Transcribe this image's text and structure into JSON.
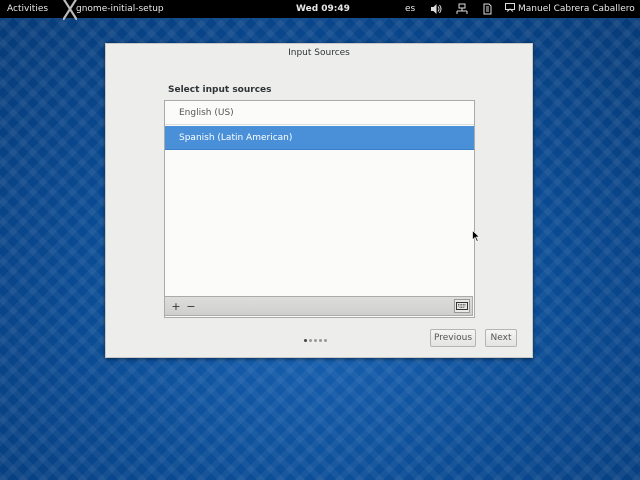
{
  "topbar": {
    "activities": "Activities",
    "app_name": "gnome-initial-setup",
    "clock": "Wed 09:49",
    "language": "es",
    "user_name": "Manuel Cabrera Caballero"
  },
  "window": {
    "title": "Input Sources",
    "section_label": "Select input sources",
    "sources": [
      {
        "label": "English (US)",
        "selected": false
      },
      {
        "label": "Spanish (Latin American)",
        "selected": true
      }
    ],
    "toolbar": {
      "add": "+",
      "remove": "−"
    },
    "pages": {
      "current": 1,
      "total": 5
    },
    "buttons": {
      "previous": "Previous",
      "next": "Next"
    }
  },
  "colors": {
    "selection": "#4a90d9",
    "desktop": "#0a4c95",
    "topbar": "#000000"
  }
}
